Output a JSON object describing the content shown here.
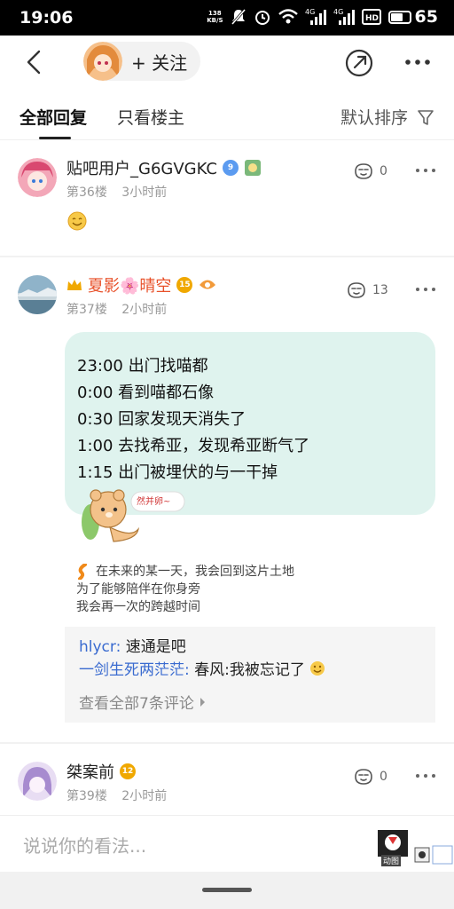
{
  "status_bar": {
    "time": "19:06",
    "net_speed_value": "138",
    "net_speed_unit": "KB/S",
    "battery": "65",
    "network_1": "4G",
    "network_2": "4G",
    "hd_label": "HD"
  },
  "nav": {
    "follow_label": "+ 关注",
    "icons": [
      "back-icon",
      "share-icon",
      "more-icon"
    ]
  },
  "tabs": {
    "all_replies": "全部回复",
    "owner_only": "只看楼主",
    "sort": "默认排序"
  },
  "posts": [
    {
      "username": "贴吧用户_G6GVGKC",
      "badge_level": "9",
      "floor": "第36楼",
      "time": "3小时前",
      "likes": "0",
      "content_emoji": "smile-face"
    },
    {
      "username": "夏影🌸晴空",
      "badge_level": "15",
      "floor": "第37楼",
      "time": "2小时前",
      "likes": "13",
      "lines": [
        "23:00 出门找喵都",
        "0:00 看到喵都石像",
        "0:30 回家发现天消失了",
        "1:00 去找希亚，发现希亚断气了",
        "1:15 出门被埋伏的与一干掉"
      ],
      "sticker_text": "然并卵~",
      "signature": [
        "在未来的某一天，我会回到这片土地",
        "为了能够陪伴在你身旁",
        "我会再一次的跨越时间"
      ],
      "comments": [
        {
          "user": "hlycr:",
          "text": "速通是吧"
        },
        {
          "user": "一剑生死两茫茫:",
          "text": "春风:我被忘记了"
        }
      ],
      "view_all": "查看全部7条评论"
    },
    {
      "username": "桀案前",
      "badge_level": "12",
      "floor": "第39楼",
      "time": "2小时前",
      "likes": "0"
    }
  ],
  "input": {
    "placeholder": "说说你的看法...",
    "sticker_label": "动图"
  },
  "colors": {
    "bubble_bg": "#dff3ee",
    "vip_name": "#e8512a",
    "comment_user": "#3a6bd0",
    "badge_blue": "#5b9bf0",
    "badge_gold": "#f0a800"
  }
}
